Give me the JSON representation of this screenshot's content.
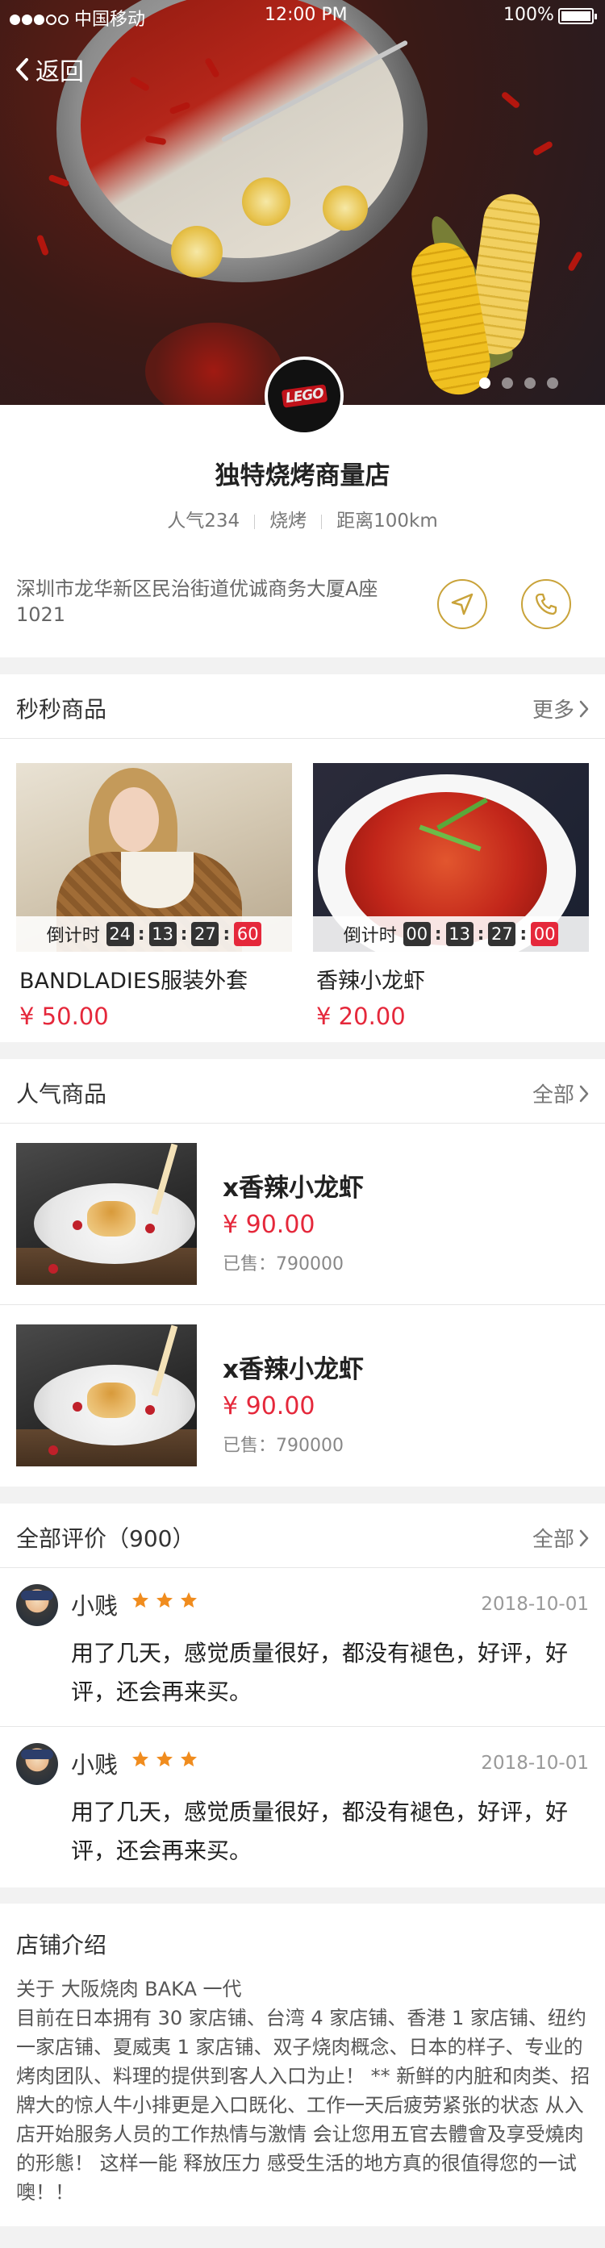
{
  "status_bar": {
    "carrier": "中国移动",
    "time": "12:00 PM",
    "battery": "100%"
  },
  "nav": {
    "back_label": "返回"
  },
  "hero": {
    "slide_count": 4,
    "active_slide": 1
  },
  "store": {
    "logo_text": "LEGO",
    "name": "独特烧烤商量店",
    "popularity": "人气234",
    "category": "烧烤",
    "distance": "距离100km",
    "address": "深圳市龙华新区民治街道优诚商务大厦A座1021",
    "accent_color": "#c9a33a"
  },
  "flash_sale": {
    "title": "秒秒商品",
    "more_label": "更多",
    "countdown_label": "倒计时",
    "items": [
      {
        "name": "BANDLADIES服装外套",
        "price": "¥ 50.00",
        "countdown": [
          "24",
          "13",
          "27",
          "60"
        ]
      },
      {
        "name": "香辣小龙虾",
        "price": "¥ 20.00",
        "countdown": [
          "00",
          "13",
          "27",
          "00"
        ]
      }
    ]
  },
  "popular": {
    "title": "人气商品",
    "more_label": "全部",
    "items": [
      {
        "name": "x香辣小龙虾",
        "price": "¥ 90.00",
        "sold": "已售：790000"
      },
      {
        "name": "x香辣小龙虾",
        "price": "¥ 90.00",
        "sold": "已售：790000"
      }
    ]
  },
  "reviews": {
    "title": "全部评价（900）",
    "more_label": "全部",
    "items": [
      {
        "user": "小贱",
        "rating": 3,
        "date": "2018-10-01",
        "text": "用了几天，感觉质量很好，都没有褪色，好评，好评，还会再来买。"
      },
      {
        "user": "小贱",
        "rating": 3,
        "date": "2018-10-01",
        "text": "用了几天，感觉质量很好，都没有褪色，好评，好评，还会再来买。"
      }
    ]
  },
  "intro": {
    "title": "店铺介绍",
    "text": "关于 大阪烧肉 BAKA 一代\n目前在日本拥有 30 家店铺、台湾 4 家店铺、香港 1 家店铺、纽约一家店铺、夏威夷 1 家店铺、双子烧肉概念、日本的样子、专业的烤肉团队、料理的提供到客人入口为止！ ** 新鲜的内脏和肉类、招牌大的惊人牛小排更是入口既化、工作一天后疲劳紧张的状态 从入店开始服务人员的工作热情与激情 会让您用五官去體會及享受燒肉的形態！ 这样一能 释放压力 感受生活的地方真的很值得您的一试噢！！"
  },
  "colors": {
    "price_red": "#e5283b",
    "star_orange": "#f08c1e"
  }
}
